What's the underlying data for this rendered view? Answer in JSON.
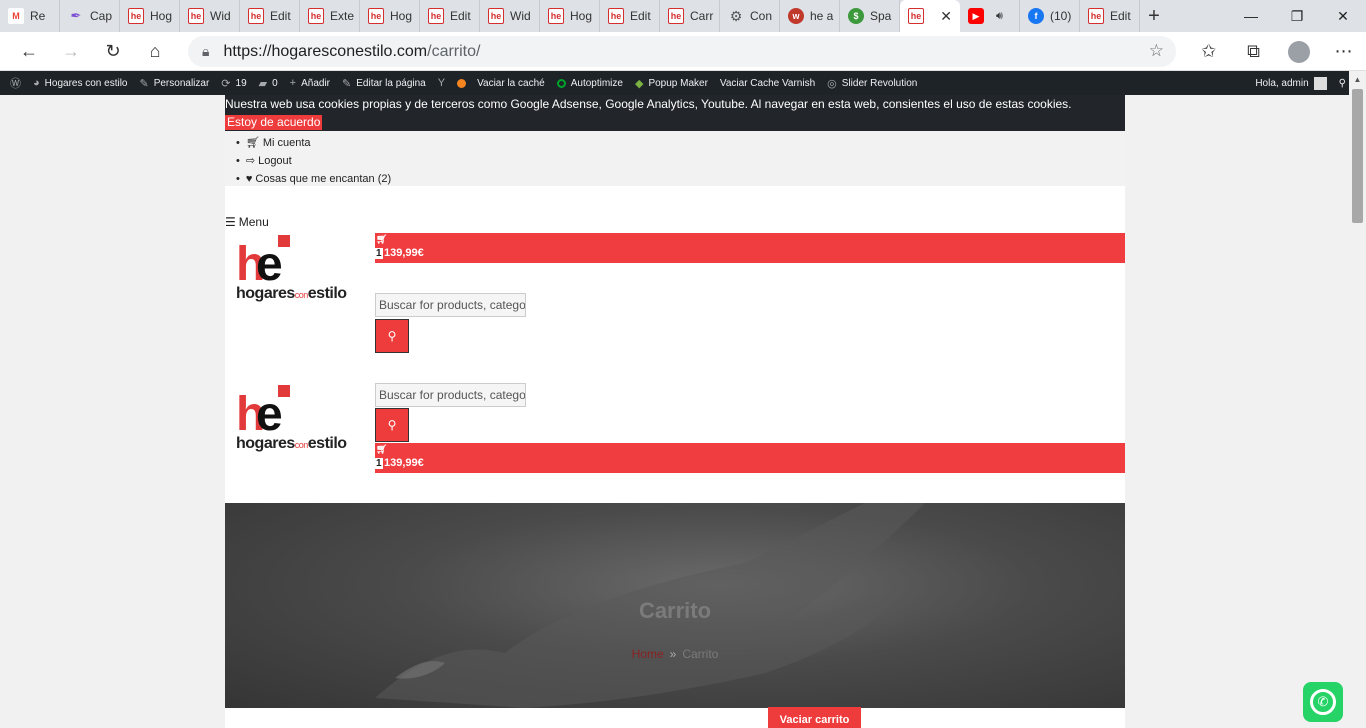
{
  "browser": {
    "tabs": [
      {
        "label": "Re",
        "favicon": "gmail-icon"
      },
      {
        "label": "Cap",
        "favicon": "feather-pen-icon"
      },
      {
        "label": "Hog",
        "favicon": "he-icon"
      },
      {
        "label": "Wid",
        "favicon": "he-icon"
      },
      {
        "label": "Edit",
        "favicon": "he-icon"
      },
      {
        "label": "Exte",
        "favicon": "he-icon"
      },
      {
        "label": "Hog",
        "favicon": "he-icon"
      },
      {
        "label": "Edit",
        "favicon": "he-icon"
      },
      {
        "label": "Wid",
        "favicon": "he-icon"
      },
      {
        "label": "Hog",
        "favicon": "he-icon"
      },
      {
        "label": "Edit",
        "favicon": "he-icon"
      },
      {
        "label": "Carr",
        "favicon": "he-icon"
      },
      {
        "label": "Con",
        "favicon": "gear-icon"
      },
      {
        "label": "he a",
        "favicon": "wi-icon"
      },
      {
        "label": "Spa",
        "favicon": "dollar-icon"
      },
      {
        "label": "",
        "favicon": "he-icon",
        "active": true
      },
      {
        "label": "",
        "favicon": "youtube-icon"
      },
      {
        "label": "(10)",
        "favicon": "facebook-icon"
      },
      {
        "label": "Edit",
        "favicon": "he-icon"
      }
    ],
    "url": "https://hogaresconestilo.com/carrito/",
    "url_host": "https://hogaresconestilo.com",
    "url_path": "/carrito/"
  },
  "wpbar": {
    "site": "Hogares con estilo",
    "customize": "Personalizar",
    "updates": "19",
    "comments": "0",
    "new": "Añadir",
    "edit_page": "Editar la página",
    "clear_cache": "Vaciar la caché",
    "autoptimize": "Autoptimize",
    "popup_maker": "Popup Maker",
    "varnish": "Vaciar Cache Varnish",
    "slider": "Slider Revolution",
    "greeting": "Hola, admin"
  },
  "cookie": {
    "text": "Nuestra web usa cookies propias y de terceros como Google Adsense, Google Analytics, Youtube. Al navegar en esta web, consientes el uso de estas cookies.",
    "accept": "Estoy de acuerdo"
  },
  "usermenu": {
    "account": "Mi cuenta",
    "logout": "Logout",
    "wishlist": "Cosas que me encantan (2)"
  },
  "menu_label": "Menu",
  "logo": {
    "brand_pre": "hogares",
    "brand_con": "con",
    "brand_post": "estilo"
  },
  "cart": {
    "count": "1",
    "total": "139,99€"
  },
  "search": {
    "placeholder": "Buscar for products, categories"
  },
  "hero": {
    "title": "Carrito",
    "breadcrumb_home": "Home",
    "breadcrumb_sep": "»",
    "breadcrumb_current": "Carrito"
  },
  "buttons": {
    "empty_cart": "Vaciar carrito"
  },
  "colors": {
    "accent": "#ee3b3b",
    "wpbar": "#1d2327",
    "cookie_bg": "#222529"
  }
}
